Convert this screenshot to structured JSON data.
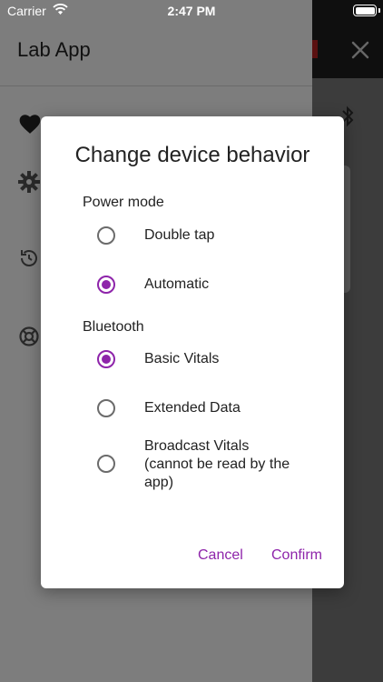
{
  "status_bar": {
    "carrier": "Carrier",
    "time": "2:47 PM"
  },
  "drawer": {
    "title": "Lab App"
  },
  "dialog": {
    "title": "Change device behavior",
    "power_mode": {
      "label": "Power mode",
      "options": [
        {
          "label": "Double tap",
          "checked": false
        },
        {
          "label": "Automatic",
          "checked": true
        }
      ]
    },
    "bluetooth": {
      "label": "Bluetooth",
      "options": [
        {
          "label": "Basic Vitals",
          "checked": true
        },
        {
          "label": "Extended Data",
          "checked": false
        },
        {
          "label": "Broadcast Vitals\n(cannot be read by the\napp)",
          "checked": false
        }
      ]
    },
    "cancel_label": "Cancel",
    "confirm_label": "Confirm"
  },
  "colors": {
    "accent": "#8e24aa"
  }
}
